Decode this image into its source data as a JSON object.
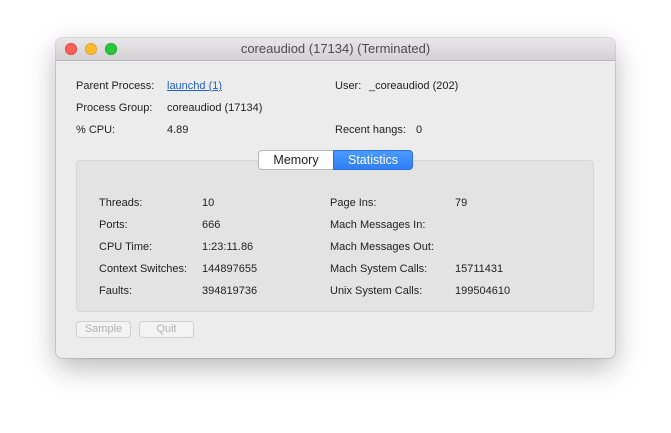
{
  "window": {
    "title": "coreaudiod (17134) (Terminated)"
  },
  "info": {
    "parent_process_label": "Parent Process:",
    "parent_process_value": "launchd (1)",
    "user_label": "User:",
    "user_value": "_coreaudiod (202)",
    "process_group_label": "Process Group:",
    "process_group_value": "coreaudiod (17134)",
    "cpu_label": "% CPU:",
    "cpu_value": "4.89",
    "recent_hangs_label": "Recent hangs:",
    "recent_hangs_value": "0"
  },
  "tabs": {
    "memory_label": "Memory",
    "statistics_label": "Statistics",
    "selected": "Statistics"
  },
  "stats": {
    "left": [
      {
        "label": "Threads:",
        "value": "10"
      },
      {
        "label": "Ports:",
        "value": "666"
      },
      {
        "label": "CPU Time:",
        "value": "1:23:11.86"
      },
      {
        "label": "Context Switches:",
        "value": "144897655"
      },
      {
        "label": "Faults:",
        "value": "394819736"
      }
    ],
    "right": [
      {
        "label": "Page Ins:",
        "value": "79"
      },
      {
        "label": "Mach Messages In:",
        "value": ""
      },
      {
        "label": "Mach Messages Out:",
        "value": ""
      },
      {
        "label": "Mach System Calls:",
        "value": "15711431"
      },
      {
        "label": "Unix System Calls:",
        "value": "199504610"
      }
    ]
  },
  "buttons": {
    "sample_label": "Sample",
    "quit_label": "Quit"
  },
  "colors": {
    "selected_tab": "#2f7ef5",
    "link": "#2262c6",
    "close": "#fe5f57",
    "minimize": "#febc2e",
    "maximize": "#28c840"
  }
}
